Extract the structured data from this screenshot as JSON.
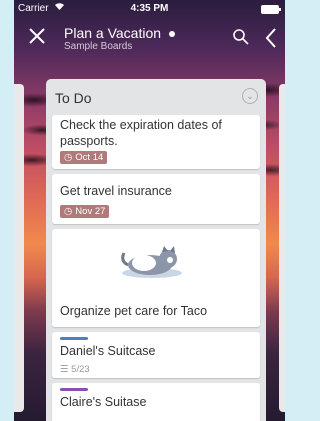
{
  "status_bar": {
    "carrier": "Carrier",
    "time": "4:35 PM"
  },
  "header": {
    "title": "Plan a Vacation",
    "subtitle": "Sample Boards",
    "close_icon": "close-icon",
    "search_icon": "search-icon",
    "back_icon": "chevron-left-icon"
  },
  "list": {
    "title": "To Do",
    "cards": [
      {
        "text": "Check the expiration dates of passports.",
        "due": "Oct 14"
      },
      {
        "text": "Get travel insurance",
        "due": "Nov 27"
      },
      {
        "text": "Organize pet care for Taco",
        "image": "cat-sleeping-illustration"
      },
      {
        "text": "Daniel's Suitcase",
        "label_color": "#4a7fc1",
        "checklist": "5/23"
      },
      {
        "text": "Claire's Suitase",
        "label_color": "#8a4fb0"
      }
    ]
  },
  "colors": {
    "due_badge": "#b07a7a",
    "list_bg": "#e3e4e6",
    "page_bg": "#d4eef6"
  }
}
